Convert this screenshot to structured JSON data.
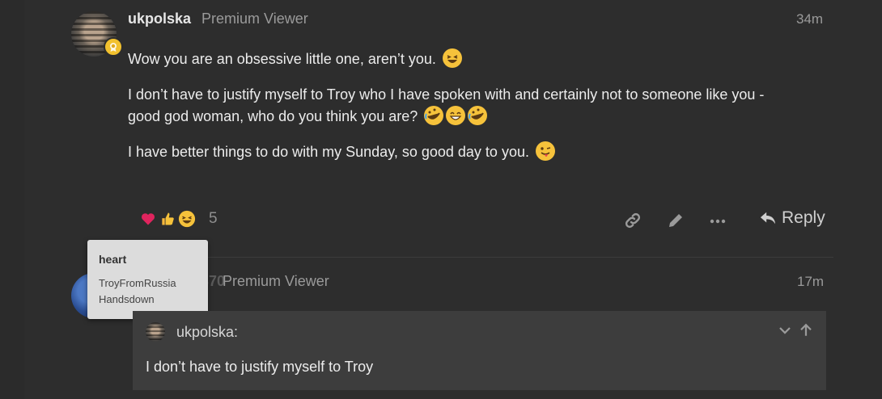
{
  "post1": {
    "username": "ukpolska",
    "user_title": "Premium Viewer",
    "time": "34m",
    "paragraphs": [
      "Wow you are an obsessive little one, aren’t you.",
      "I don’t have to justify myself to Troy who I have spoken with and certainly not to someone like you -",
      "good god woman, who do you think you are?",
      "I have better things to do with my Sunday, so good day to you."
    ],
    "reactions": [
      "heart",
      "thumbs-up",
      "grinning-squinting-face"
    ],
    "reaction_count": "5",
    "reply_label": "Reply"
  },
  "tooltip": {
    "title": "heart",
    "users": [
      "TroyFromRussia",
      "Handsdown"
    ]
  },
  "post2": {
    "username": "…1370",
    "user_title": "Premium Viewer",
    "time": "17m"
  },
  "quote": {
    "username": "ukpolska:",
    "text": "I don’t have to justify myself to Troy"
  },
  "colors": {
    "background": "#2d2d2d",
    "heart": "#e0245e",
    "quote_bg": "#3d3d3d",
    "tooltip_bg": "#dcdcdc"
  }
}
